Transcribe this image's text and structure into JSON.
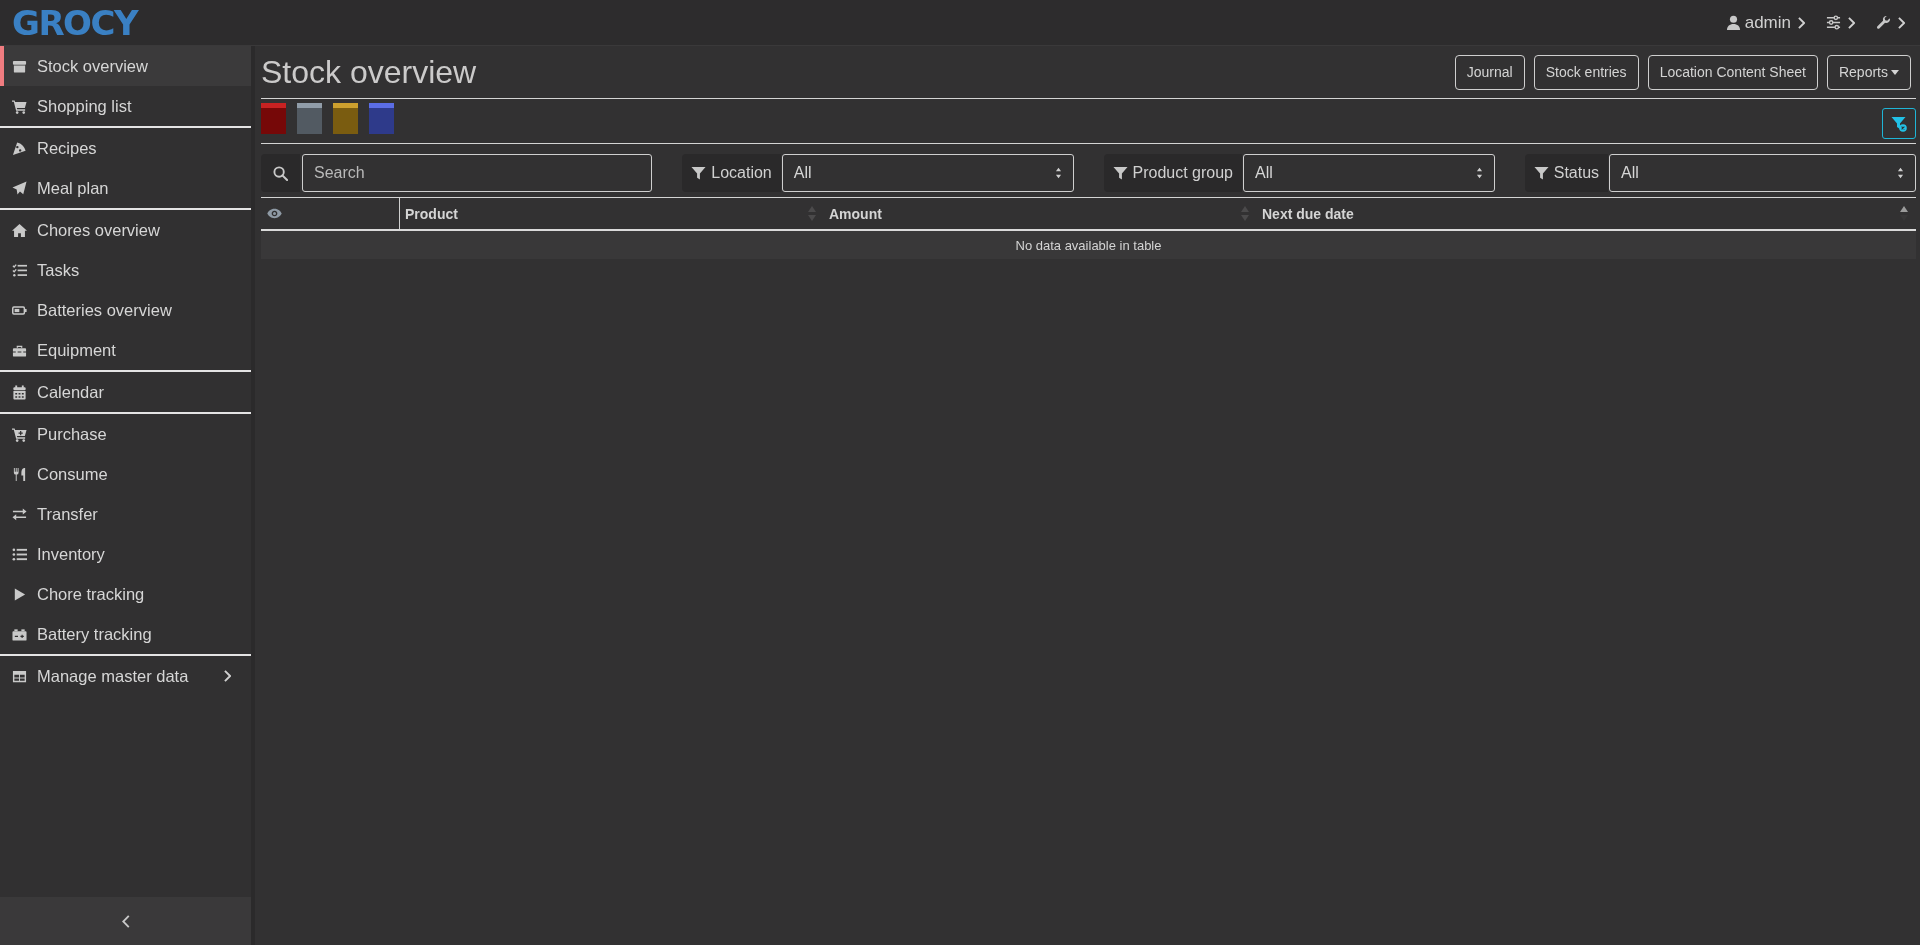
{
  "topbar": {
    "logo": "GROCY",
    "user": "admin"
  },
  "sidebar": {
    "groups": [
      {
        "items": [
          {
            "label": "Stock overview",
            "selected": true
          },
          {
            "label": "Shopping list",
            "selected": false
          }
        ]
      },
      {
        "items": [
          {
            "label": "Recipes",
            "selected": false
          },
          {
            "label": "Meal plan",
            "selected": false
          }
        ]
      },
      {
        "items": [
          {
            "label": "Chores overview",
            "selected": false
          },
          {
            "label": "Tasks",
            "selected": false
          },
          {
            "label": "Batteries overview",
            "selected": false
          },
          {
            "label": "Equipment",
            "selected": false
          }
        ]
      },
      {
        "items": [
          {
            "label": "Calendar",
            "selected": false
          }
        ]
      },
      {
        "items": [
          {
            "label": "Purchase",
            "selected": false
          },
          {
            "label": "Consume",
            "selected": false
          },
          {
            "label": "Transfer",
            "selected": false
          },
          {
            "label": "Inventory",
            "selected": false
          },
          {
            "label": "Chore tracking",
            "selected": false
          },
          {
            "label": "Battery tracking",
            "selected": false
          }
        ]
      }
    ],
    "master_data": {
      "label": "Manage master data",
      "expanded": false
    }
  },
  "page": {
    "title": "Stock overview",
    "actions": [
      {
        "label": "Journal",
        "kind": "button"
      },
      {
        "label": "Stock entries",
        "kind": "button"
      },
      {
        "label": "Location Content Sheet",
        "kind": "button"
      },
      {
        "label": "Reports",
        "kind": "dropdown"
      }
    ]
  },
  "status_tiles": [
    {
      "color": "#760808"
    },
    {
      "color": "#525a62"
    },
    {
      "color": "#7a5c10"
    },
    {
      "color": "#2e3a8a"
    }
  ],
  "filters": {
    "search": {
      "placeholder": "Search"
    },
    "selects": [
      {
        "label": "Location",
        "value": "All"
      },
      {
        "label": "Product group",
        "value": "All"
      },
      {
        "label": "Status",
        "value": "All"
      }
    ]
  },
  "table": {
    "columns": [
      {
        "label": "Product",
        "sorted": false
      },
      {
        "label": "Amount",
        "sorted": false
      },
      {
        "label": "Next due date",
        "sorted": true
      }
    ],
    "empty_message": "No data available in table"
  }
}
